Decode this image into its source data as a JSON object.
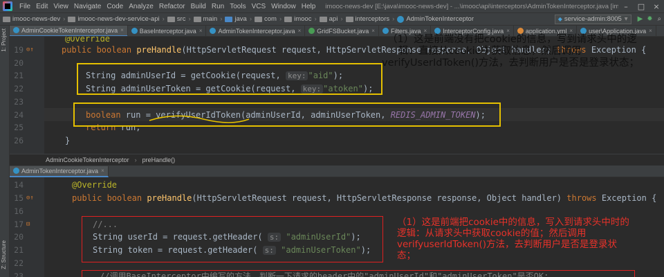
{
  "menubar": {
    "items": [
      "File",
      "Edit",
      "View",
      "Navigate",
      "Code",
      "Analyze",
      "Refactor",
      "Build",
      "Run",
      "Tools",
      "VCS",
      "Window",
      "Help"
    ],
    "window_title": "imooc-news-dev [E:\\java\\imooc-news-dev] - ...\\imooc\\api\\interceptors\\AdminTokenInterceptor.java [imooc-news-dev-service-api]"
  },
  "navbar": {
    "crumbs": [
      "imooc-news-dev",
      "imooc-news-dev-service-api",
      "src",
      "main",
      "java",
      "com",
      "imooc",
      "api",
      "interceptors",
      "AdminTokenInterceptor"
    ],
    "run_config": "service-admin:8005"
  },
  "tabs": [
    {
      "label": "AdminCookieTokenInterceptor.java",
      "icon": "class-icon",
      "active": true
    },
    {
      "label": "BaseInterceptor.java",
      "icon": "class-icon"
    },
    {
      "label": "AdminTokenInterceptor.java",
      "icon": "class-icon"
    },
    {
      "label": "GridFSBucket.java",
      "icon": "class-icon"
    },
    {
      "label": "Filters.java",
      "icon": "class-icon"
    },
    {
      "label": "InterceptorConfig.java",
      "icon": "class-icon"
    },
    {
      "label": "application.yml",
      "icon": "yml-icon"
    },
    {
      "label": "user\\Application.java",
      "icon": "class-icon"
    }
  ],
  "toolstrip": {
    "project": "1: Project",
    "structure": "Z: Structure"
  },
  "editor_top": {
    "lines": [
      {
        "num": "",
        "tokens": [
          [
            "ann",
            "@Override"
          ]
        ]
      },
      {
        "num": "19",
        "tokens": [
          [
            "kw",
            "public boolean "
          ],
          [
            "fn",
            "preHandle"
          ],
          [
            "plain",
            "(HttpServletRequest request, HttpServletResponse response, Object handler) "
          ],
          [
            "kw",
            "throws "
          ],
          [
            "plain",
            "Exception {"
          ]
        ]
      },
      {
        "num": "20",
        "tokens": []
      },
      {
        "num": "21",
        "tokens": [
          [
            "plain",
            "String adminUserId = getCookie(request, "
          ],
          [
            "hint",
            "key:"
          ],
          [
            "str",
            "\"aid\""
          ],
          [
            "plain",
            ");"
          ]
        ]
      },
      {
        "num": "22",
        "tokens": [
          [
            "plain",
            "String adminUserToken = getCookie(request, "
          ],
          [
            "hint",
            "key:"
          ],
          [
            "str",
            "\"atoken\""
          ],
          [
            "plain",
            ");"
          ]
        ]
      },
      {
        "num": "23",
        "tokens": []
      },
      {
        "num": "24",
        "tokens": [
          [
            "kw",
            "boolean "
          ],
          [
            "plain",
            "run = verifyUserIdToken(adminUserId, adminUserToken, "
          ],
          [
            "cst",
            "REDIS_ADMIN_TOKEN"
          ],
          [
            "plain",
            ");"
          ]
        ]
      },
      {
        "num": "25",
        "tokens": [
          [
            "kw",
            "return "
          ],
          [
            "plain",
            "run;"
          ]
        ]
      },
      {
        "num": "26",
        "tokens": [
          [
            "plain",
            "}"
          ]
        ]
      }
    ],
    "breadcrumb": [
      "AdminCookieTokenInterceptor",
      "preHandle()"
    ]
  },
  "editor_bottom": {
    "tab": "AdminTokenInterceptor.java",
    "lines": [
      {
        "num": "14",
        "tokens": [
          [
            "ann",
            "@Override"
          ]
        ]
      },
      {
        "num": "15",
        "tokens": [
          [
            "kw",
            "public boolean "
          ],
          [
            "fn",
            "preHandle"
          ],
          [
            "plain",
            "(HttpServletRequest request, HttpServletResponse response, Object handler) "
          ],
          [
            "kw",
            "throws "
          ],
          [
            "plain",
            "Exception {"
          ]
        ]
      },
      {
        "num": "16",
        "tokens": []
      },
      {
        "num": "17",
        "tokens": [
          [
            "cmt",
            "//..."
          ]
        ]
      },
      {
        "num": "20",
        "tokens": [
          [
            "plain",
            "String userId = request.getHeader( "
          ],
          [
            "hint",
            "s:"
          ],
          [
            "str",
            " \"adminUserId\""
          ],
          [
            "plain",
            ");"
          ]
        ]
      },
      {
        "num": "21",
        "tokens": [
          [
            "plain",
            "String token = request.getHeader( "
          ],
          [
            "hint",
            "s:"
          ],
          [
            "str",
            " \"adminUserToken\""
          ],
          [
            "plain",
            ");"
          ]
        ]
      },
      {
        "num": "22",
        "tokens": []
      },
      {
        "num": "23",
        "tokens": [
          [
            "cmt",
            "//调用BaseInterceptor中编写的方法，判断一下请求的header中的\"adminUserId\"和\"adminUserToken\"是否OK;"
          ]
        ]
      }
    ]
  },
  "annotations": {
    "top_note": [
      "（1）这是前端没有把cookie的信息，写到请求头中的逻",
      "辑：直接从cookie中获取信息，然后调用",
      "verifyUserIdToken()方法，去判断用户是否是登录状态；"
    ],
    "bottom_note": [
      "（1）这是前端把cookie中的信息，写入到请求头中时的",
      "逻辑：从请求头中获取cookie的值；然后调用",
      "verifyuserIdToken()方法，去判断用户是否是登录状",
      "态；"
    ],
    "colors": {
      "yellow": "#e5c000",
      "red": "#e02020"
    }
  }
}
